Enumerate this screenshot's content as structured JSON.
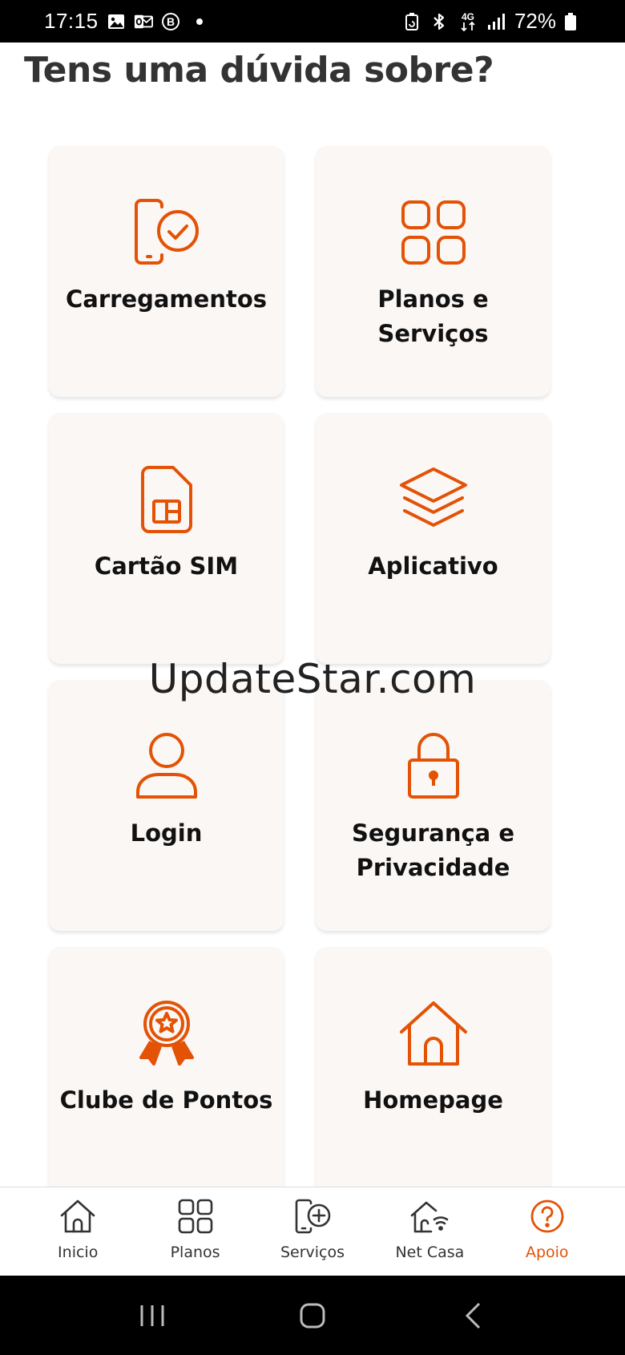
{
  "status_bar": {
    "time": "17:15",
    "battery": "72%",
    "network": "4G",
    "icons_left": [
      "image-icon",
      "outlook-icon",
      "b-badge-icon",
      "dot-icon"
    ],
    "icons_right": [
      "battery-saver-icon",
      "bluetooth-icon",
      "4g-icon",
      "signal-icon",
      "battery-icon"
    ]
  },
  "page": {
    "title": "Tens uma dúvida sobre?"
  },
  "topics": [
    {
      "label": "Carregamentos",
      "icon": "phone-check-icon"
    },
    {
      "label": "Planos e Serviços",
      "icon": "grid-icon"
    },
    {
      "label": "Cartão SIM",
      "icon": "sim-card-icon"
    },
    {
      "label": "Aplicativo",
      "icon": "layers-icon"
    },
    {
      "label": "Login",
      "icon": "user-icon"
    },
    {
      "label": "Segurança e Privacidade",
      "icon": "lock-icon"
    },
    {
      "label": "Clube de Pontos",
      "icon": "award-icon"
    },
    {
      "label": "Homepage",
      "icon": "home-icon"
    }
  ],
  "watermark": "UpdateStar.com",
  "bottom_nav": {
    "items": [
      {
        "label": "Inicio",
        "icon": "home-icon",
        "active": false
      },
      {
        "label": "Planos",
        "icon": "grid-icon",
        "active": false
      },
      {
        "label": "Serviços",
        "icon": "phone-plus-icon",
        "active": false
      },
      {
        "label": "Net Casa",
        "icon": "home-wifi-icon",
        "active": false
      },
      {
        "label": "Apoio",
        "icon": "question-icon",
        "active": true
      }
    ]
  },
  "colors": {
    "accent": "#e35205",
    "card_bg": "#faf7f5",
    "title": "#333333"
  }
}
